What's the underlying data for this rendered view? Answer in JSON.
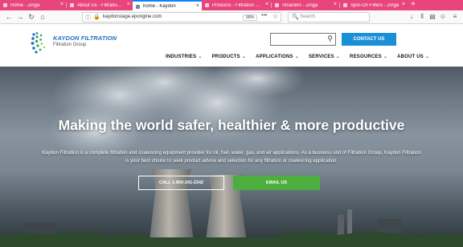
{
  "browser": {
    "tabs": [
      {
        "title": "Home - Zinga",
        "active": false
      },
      {
        "title": "About Us - Filtration Grou",
        "active": false
      },
      {
        "title": "home - Kaydon",
        "active": true
      },
      {
        "title": "Products - Filtration Grou",
        "active": false
      },
      {
        "title": "Strainers - Zinga",
        "active": false
      },
      {
        "title": "Spin-On Filters - Zinga",
        "active": false
      }
    ],
    "new_tab_glyph": "+",
    "url": "kaydonstage.epongine.com",
    "zoom": "90%",
    "search_placeholder": "Search",
    "accent_color": "#e8467a"
  },
  "site": {
    "logo": {
      "name": "KAYDON FILTRATION",
      "subtitle": "Filtration Group"
    },
    "contact_label": "CONTACT US",
    "nav": [
      "INDUSTRIES",
      "PRODUCTS",
      "APPLICATIONS",
      "SERVICES",
      "RESOURCES",
      "ABOUT US"
    ],
    "brand_color": "#1a8fd6"
  },
  "hero": {
    "title": "Making the world safer, healthier & more productive",
    "body": "Kaydon Filtration is a complete filtration and coalescing equipment provider for oil, fuel, water, gas, and air applications. As a business unit of Filtration Group, Kaydon Filtration is your best choice to seek product advice and selection for any filtration or coalescing application.",
    "call_label": "CALL 1-800-241-2342",
    "email_label": "EMAIL US",
    "email_color": "#4cae3f"
  },
  "icons": {
    "back": "←",
    "forward": "→",
    "reload": "↻",
    "home": "⌂",
    "info": "ⓘ",
    "lock": "🔒",
    "more": "•••",
    "bookmark": "☆",
    "search": "🔍",
    "download": "↓",
    "library": "⫴",
    "sidebar": "▤",
    "account": "☺",
    "menu": "≡",
    "close": "×",
    "chevron": "⌄",
    "magnifier": "⚲"
  }
}
